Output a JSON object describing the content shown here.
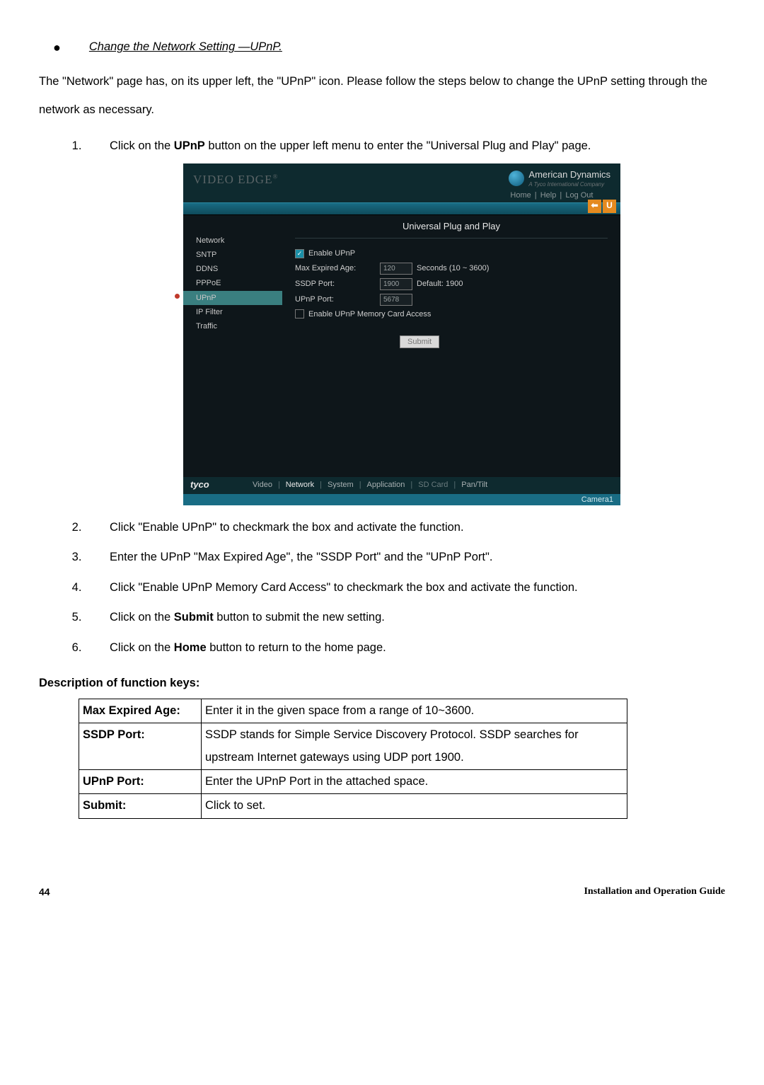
{
  "section_heading": "Change the Network Setting —UPnP.",
  "intro": "The \"Network\" page has, on its upper left, the \"UPnP\" icon. Please follow the steps below to change the UPnP setting through the network as necessary.",
  "steps": {
    "s1_a": "Click on the ",
    "s1_b": "UPnP",
    "s1_c": " button on the upper left menu to enter the \"Universal Plug and Play\" page.",
    "s2": "Click \"Enable UPnP\" to checkmark the box and activate the function.",
    "s3": "Enter the UPnP \"Max Expired Age\", the \"SSDP Port\" and the \"UPnP Port\".",
    "s4": "Click \"Enable UPnP Memory Card Access\" to checkmark the box and activate the function.",
    "s5_a": "Click on the ",
    "s5_b": "Submit",
    "s5_c": " button to submit the new setting.",
    "s6_a": "Click on the ",
    "s6_b": "Home",
    "s6_c": " button to return to the home page."
  },
  "screenshot": {
    "logo": "VIDEO EDGE",
    "brand": "American Dynamics",
    "brand_sub": "A Tyco International Company",
    "toplinks": {
      "home": "Home",
      "help": "Help",
      "logout": "Log Out"
    },
    "side": {
      "network": "Network",
      "sntp": "SNTP",
      "ddns": "DDNS",
      "pppoe": "PPPoE",
      "upnp": "UPnP",
      "ipfilter": "IP Filter",
      "traffic": "Traffic"
    },
    "panel": {
      "title": "Universal Plug and Play",
      "enable_upnp": "Enable UPnP",
      "max_age_label": "Max Expired Age:",
      "max_age_val": "120",
      "max_age_hint": "Seconds (10 ~ 3600)",
      "ssdp_label": "SSDP Port:",
      "ssdp_val": "1900",
      "ssdp_hint": "Default: 1900",
      "upnp_port_label": "UPnP Port:",
      "upnp_port_val": "5678",
      "enable_mem": "Enable UPnP Memory Card Access",
      "submit": "Submit"
    },
    "footer": {
      "tyco": "tyco",
      "tabs": {
        "video": "Video",
        "network": "Network",
        "system": "System",
        "application": "Application",
        "sdcard": "SD Card",
        "pantilt": "Pan/Tilt"
      },
      "camera": "Camera1",
      "arrow": "⬅",
      "u": "U"
    }
  },
  "desc_heading": "Description of function keys:",
  "desc": {
    "r1k": "Max Expired Age:",
    "r1v": "Enter it in the given space from a range of 10~3600.",
    "r2k": "SSDP Port:",
    "r2v": "SSDP stands for Simple Service Discovery Protocol. SSDP searches for upstream Internet gateways using UDP port 1900.",
    "r3k": "UPnP Port:",
    "r3v": "Enter the UPnP Port in the attached space.",
    "r4k": "Submit:",
    "r4v": "Click to set."
  },
  "page_num": "44",
  "guide_title": "Installation and Operation Guide"
}
